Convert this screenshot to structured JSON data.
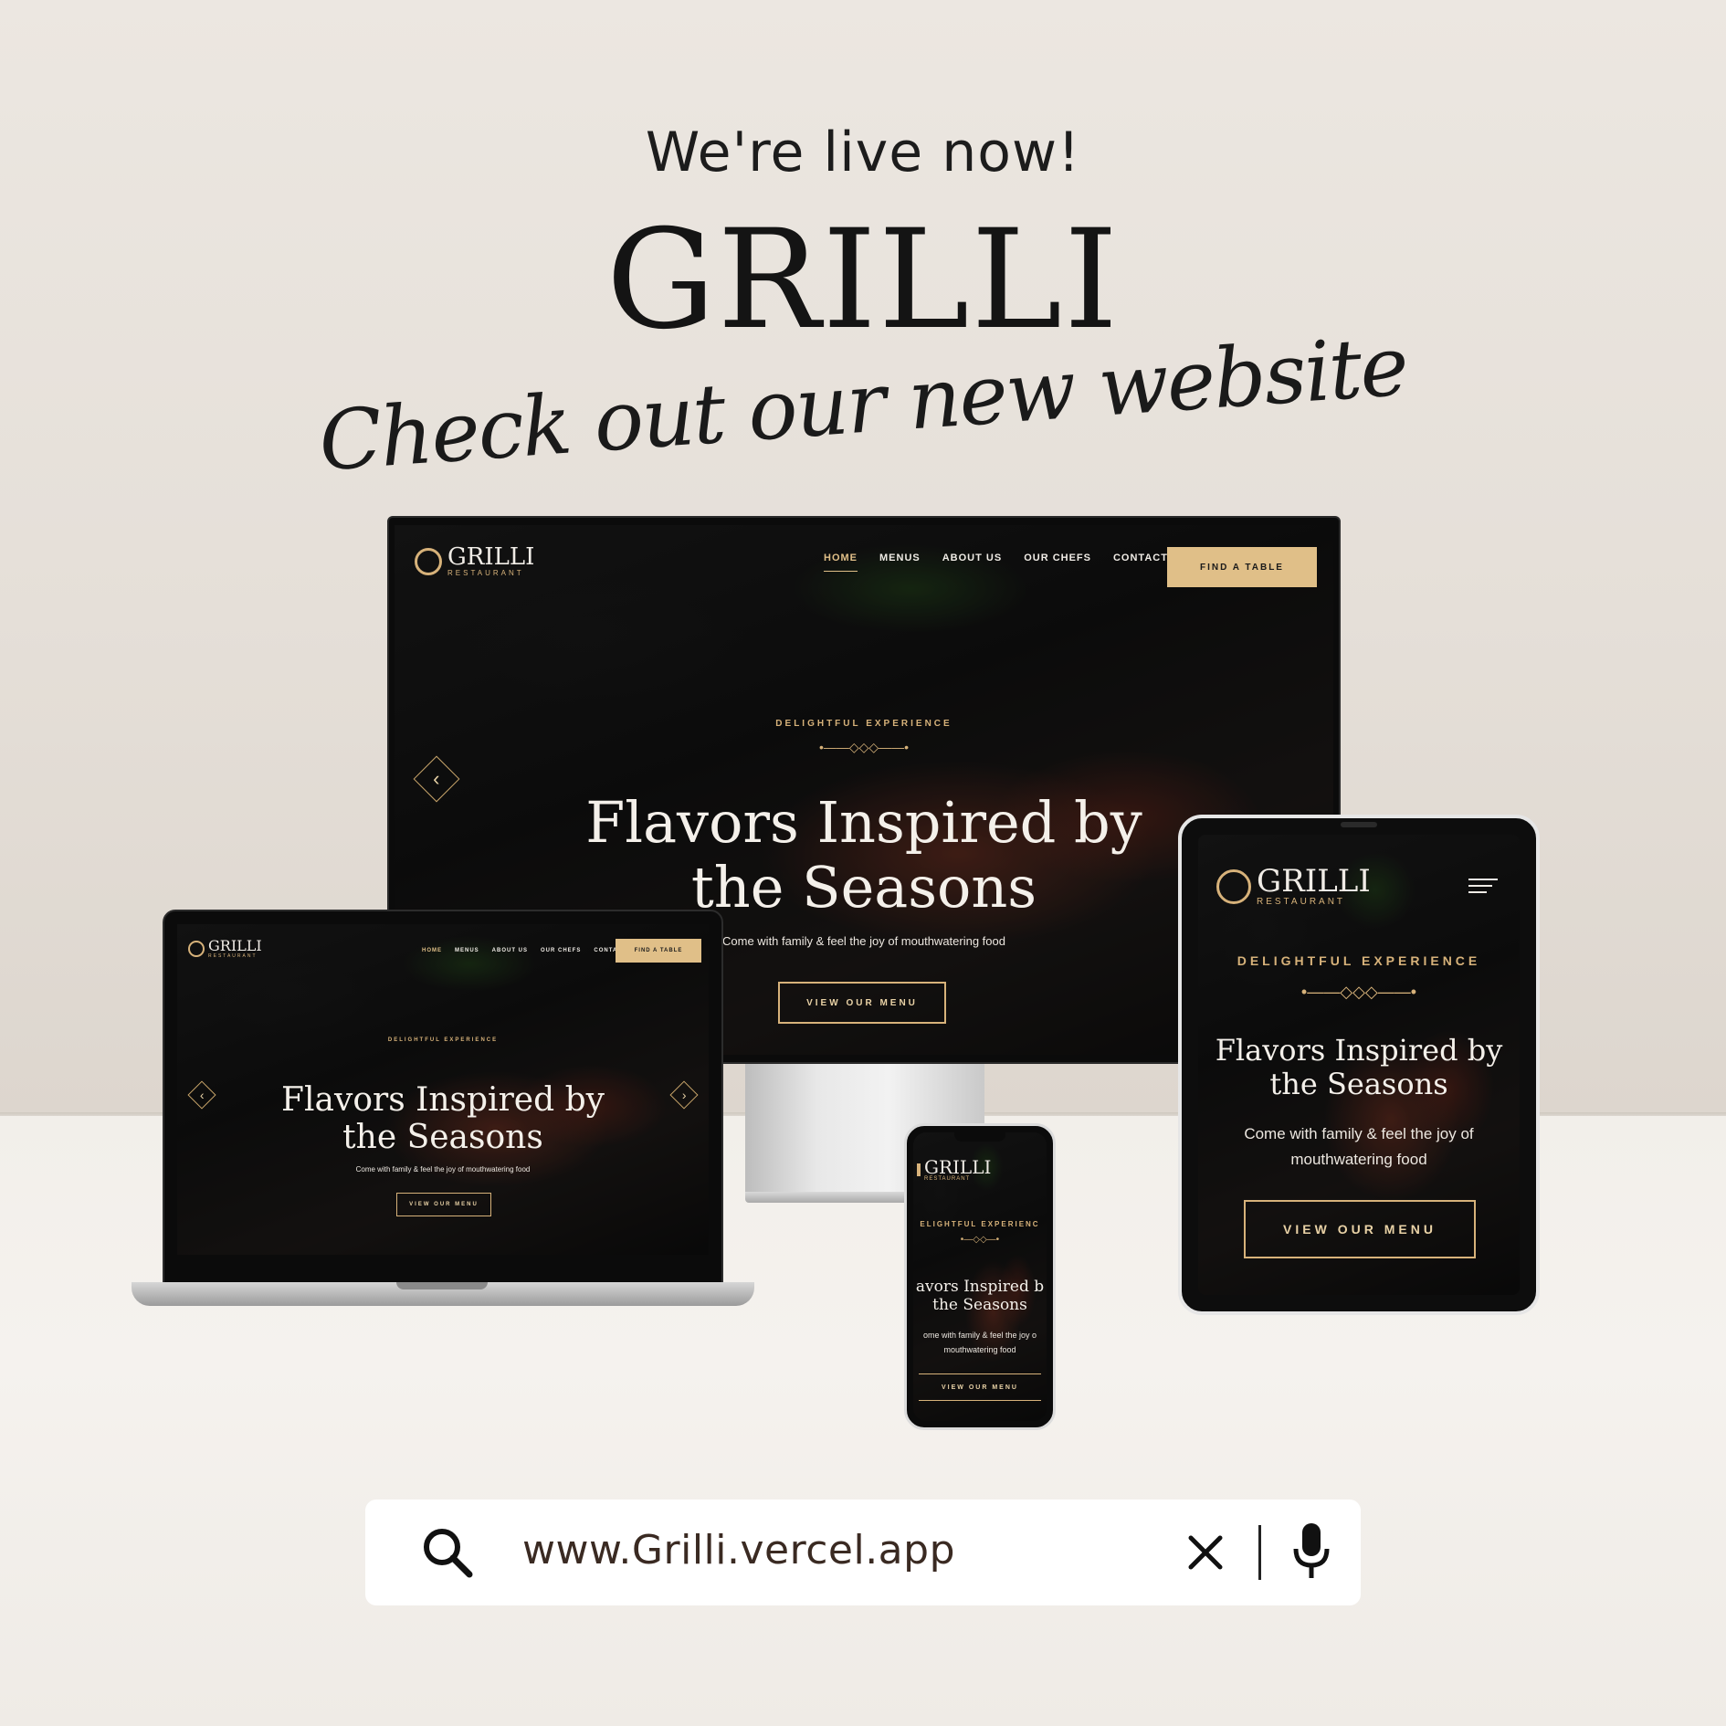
{
  "header": {
    "headline": "We're live now!",
    "brand": "GRILLI",
    "tagline": "Check out our new website"
  },
  "site": {
    "logo_text": "GRILLI",
    "logo_sub": "RESTAURANT",
    "nav": [
      "HOME",
      "MENUS",
      "ABOUT US",
      "OUR CHEFS",
      "CONTACT"
    ],
    "cta": "FIND A TABLE",
    "eyebrow": "DELIGHTFUL EXPERIENCE",
    "hero_title_line1": "Flavors Inspired by",
    "hero_title_line2": "the Seasons",
    "hero_text": "Come with family & feel the joy of mouthwatering food",
    "hero_text_line1": "Come with family & feel the joy of",
    "hero_text_line2": "mouthwatering food",
    "button": "VIEW OUR MENU",
    "accent_color": "#e0bf88"
  },
  "phone": {
    "eyebrow": "ELIGHTFUL EXPERIENC",
    "title_line1": "avors Inspired b",
    "title_line2": "the Seasons",
    "text_line1": "ome with family & feel the joy o",
    "text_line2": "mouthwatering food"
  },
  "search": {
    "url": "www.Grilli.vercel.app",
    "icons": [
      "search-icon",
      "close-icon",
      "mic-icon"
    ]
  }
}
